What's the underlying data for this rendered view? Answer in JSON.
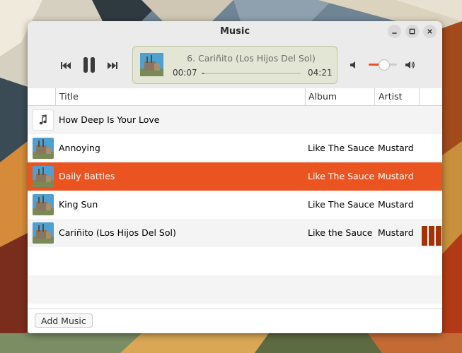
{
  "window": {
    "title": "Music"
  },
  "player": {
    "now_playing": "6. Cariñito (Los Hijos Del Sol)",
    "elapsed": "00:07",
    "total": "04:21",
    "progress_fraction": 0.03,
    "volume_fraction": 0.55,
    "state": "playing"
  },
  "columns": {
    "title": "Title",
    "album": "Album",
    "artist": "Artist"
  },
  "tracks": [
    {
      "title": "How Deep Is Your Love",
      "album": "",
      "artist": "",
      "art": "note-icon"
    },
    {
      "title": "Annoying",
      "album": "Like The Sauce",
      "artist": "Mustard",
      "art": "album-cover"
    },
    {
      "title": "Daily Battles",
      "album": "Like The Sauce",
      "artist": "Mustard",
      "art": "album-cover",
      "selected": true
    },
    {
      "title": "King Sun",
      "album": "Like The Sauce",
      "artist": "Mustard",
      "art": "album-cover"
    },
    {
      "title": "Cariñito (Los Hijos Del Sol)",
      "album": "Like the Sauce",
      "artist": "Mustard",
      "art": "album-cover",
      "playing": true
    }
  ],
  "footer": {
    "add_label": "Add Music"
  },
  "colors": {
    "accent": "#e95420",
    "playing_indicator": "#a33209",
    "alt_row": "#f4f4f4"
  }
}
